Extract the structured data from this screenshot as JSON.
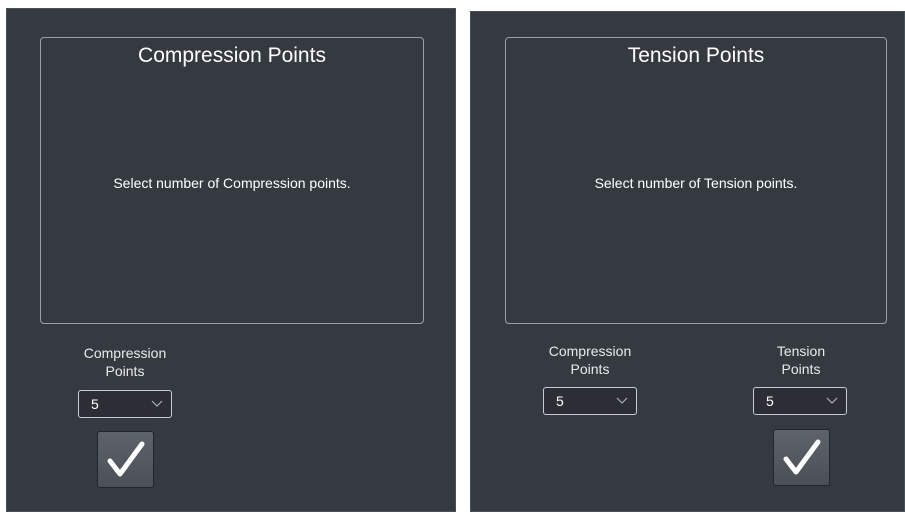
{
  "left_panel": {
    "title": "Compression Points",
    "message": "Select number of Compression points.",
    "compression_label_line1": "Compression",
    "compression_label_line2": "Points",
    "compression_value": "5"
  },
  "right_panel": {
    "title": "Tension Points",
    "message": "Select number of Tension points.",
    "compression_label_line1": "Compression",
    "compression_label_line2": "Points",
    "compression_value": "5",
    "tension_label_line1": "Tension",
    "tension_label_line2": "Points",
    "tension_value": "5"
  },
  "icons": {
    "dropdown": "chevron-down-icon",
    "confirm": "checkmark-icon"
  },
  "colors": {
    "panel_bg": "#353a41",
    "box_border": "#9aa0a8",
    "text": "#ffffff"
  }
}
